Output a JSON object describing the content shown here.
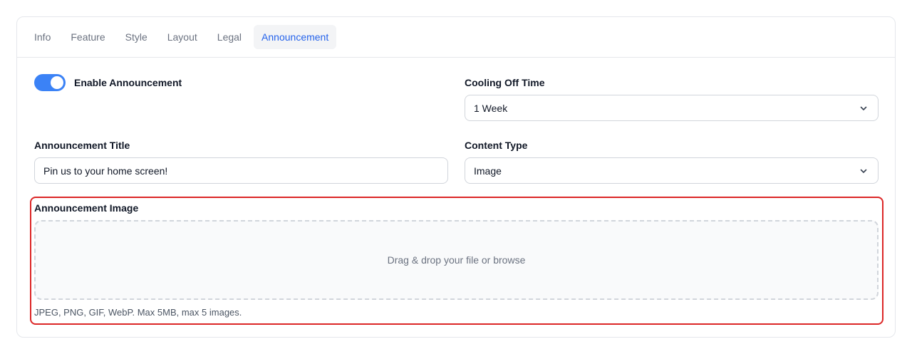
{
  "tabs": [
    {
      "label": "Info"
    },
    {
      "label": "Feature"
    },
    {
      "label": "Style"
    },
    {
      "label": "Layout"
    },
    {
      "label": "Legal"
    },
    {
      "label": "Announcement"
    }
  ],
  "enable_toggle": {
    "label": "Enable Announcement",
    "checked": true,
    "color": "#3b82f6"
  },
  "cooling_off": {
    "label": "Cooling Off Time",
    "value": "1 Week"
  },
  "announcement_title": {
    "label": "Announcement Title",
    "value": "Pin us to your home screen!"
  },
  "content_type": {
    "label": "Content Type",
    "value": "Image"
  },
  "announcement_image": {
    "label": "Announcement Image",
    "dropzone_text": "Drag & drop your file or browse",
    "help_text": "JPEG, PNG, GIF, WebP. Max 5MB, max 5 images."
  },
  "colors": {
    "accent": "#2563eb",
    "highlight": "#dc2626"
  }
}
